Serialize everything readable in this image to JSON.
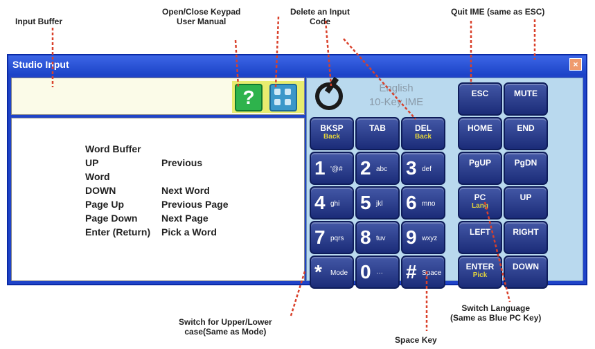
{
  "annotations": {
    "input_buffer": "Input Buffer",
    "keypad_manual": [
      "Open/Close Keypad",
      "User Manual"
    ],
    "delete_code": [
      "Delete an Input",
      "Code"
    ],
    "quit_ime": "Quit IME (same as ESC)",
    "upper_lower": [
      "Switch for Upper/Lower",
      "case(Same as Mode)"
    ],
    "space_key": "Space Key",
    "switch_language": [
      "Switch Language",
      "(Same as Blue PC Key)"
    ]
  },
  "window": {
    "title": "Studio Input",
    "close_glyph": "×"
  },
  "icons": {
    "manual": "question-icon",
    "keypad": "keypad-icon",
    "logo": "ime-logo-icon"
  },
  "word_buffer": {
    "title": "Word Buffer",
    "rows": [
      [
        "UP",
        "Previous"
      ],
      [
        "Word",
        ""
      ],
      [
        "DOWN",
        "Next Word"
      ],
      [
        "Page Up",
        "Previous Page"
      ],
      [
        "Page Down",
        "Next Page"
      ],
      [
        "Enter (Return)",
        "Pick a Word"
      ]
    ]
  },
  "keypad": {
    "mode": [
      "English",
      "10-Key IME"
    ],
    "keys": [
      {
        "main": "ESC",
        "sub": ""
      },
      {
        "main": "MUTE",
        "sub": ""
      },
      {
        "main": "BKSP",
        "sub": "Back"
      },
      {
        "main": "TAB",
        "sub": ""
      },
      {
        "main": "DEL",
        "sub": "Back"
      },
      {
        "main": "HOME",
        "sub": ""
      },
      {
        "main": "END",
        "sub": ""
      },
      {
        "main": "1",
        "sub": "'@#"
      },
      {
        "main": "2",
        "sub": "abc"
      },
      {
        "main": "3",
        "sub": "def"
      },
      {
        "main": "PgUP",
        "sub": ""
      },
      {
        "main": "PgDN",
        "sub": ""
      },
      {
        "main": "4",
        "sub": "ghi"
      },
      {
        "main": "5",
        "sub": "jkl"
      },
      {
        "main": "6",
        "sub": "mno"
      },
      {
        "main": "PC",
        "sub": "Lang"
      },
      {
        "main": "UP",
        "sub": ""
      },
      {
        "main": "7",
        "sub": "pqrs"
      },
      {
        "main": "8",
        "sub": "tuv"
      },
      {
        "main": "9",
        "sub": "wxyz"
      },
      {
        "main": "LEFT",
        "sub": ""
      },
      {
        "main": "RIGHT",
        "sub": ""
      },
      {
        "main": "*",
        "sub": "Mode"
      },
      {
        "main": "0",
        "sub": "···"
      },
      {
        "main": "#",
        "sub": "Space"
      },
      {
        "main": "ENTER",
        "sub": "Pick"
      },
      {
        "main": "DOWN",
        "sub": ""
      }
    ]
  },
  "colors": {
    "window_blue": "#1f43c8",
    "key_blue": "#1b2c78",
    "accent_yellow": "#e2d33d",
    "arrow_red": "#d9412b"
  }
}
